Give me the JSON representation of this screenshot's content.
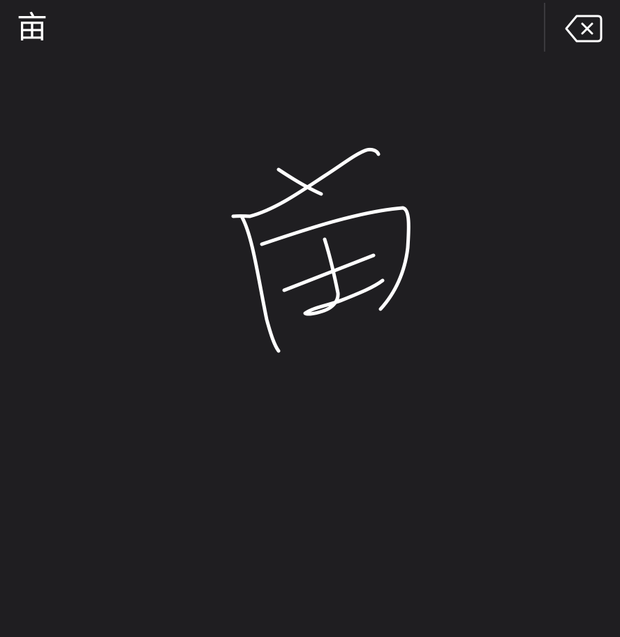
{
  "candidates": [
    {
      "label": "亩"
    }
  ],
  "delete_button": {
    "icon": "delete-backspace-icon"
  },
  "canvas": {
    "stroke_color": "#ffffff",
    "background_color": "#1f1e21"
  }
}
